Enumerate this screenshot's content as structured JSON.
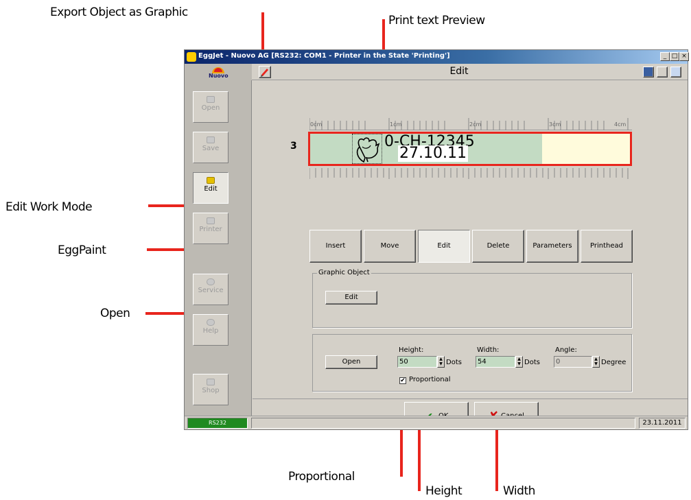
{
  "callouts": {
    "export_object_as_graphic": "Export Object as Graphic",
    "print_text_preview": "Print text Preview",
    "edit_work_mode": "Edit Work Mode",
    "eggpaint": "EggPaint",
    "open": "Open",
    "proportional": "Proportional",
    "height": "Height",
    "width": "Width"
  },
  "window": {
    "title": "EggJet - Nuovo AG   [RS232: COM1 - Printer in the State 'Printing']",
    "header_title": "Edit"
  },
  "sidebar": {
    "logo_text": "Nuovo",
    "items": [
      {
        "label": "Open",
        "icon": "folder-open-icon"
      },
      {
        "label": "Save",
        "icon": "folder-save-icon"
      },
      {
        "label": "Edit",
        "icon": "edit-icon"
      },
      {
        "label": "Printer",
        "icon": "printer-icon"
      },
      {
        "label": "Service",
        "icon": "service-icon"
      },
      {
        "label": "Help",
        "icon": "help-icon"
      },
      {
        "label": "Shop",
        "icon": "shop-icon"
      }
    ]
  },
  "status": {
    "rs232": "RS232",
    "date": "23.11.2011"
  },
  "ruler": {
    "units": [
      "0cm",
      "1cm",
      "2cm",
      "3cm",
      "4cm"
    ]
  },
  "preview": {
    "line_number": "3",
    "line1": "0-CH-12345",
    "line2": "27.10.11"
  },
  "tabs": [
    "Insert",
    "Move",
    "Edit",
    "Delete",
    "Parameters",
    "Printhead"
  ],
  "graphic_object": {
    "group_label": "Graphic Object",
    "edit_button": "Edit"
  },
  "size_panel": {
    "open_button": "Open",
    "height_label": "Height:",
    "height_value": "50",
    "height_unit": "Dots",
    "width_label": "Width:",
    "width_value": "54",
    "width_unit": "Dots",
    "angle_label": "Angle:",
    "angle_value": "0",
    "angle_unit": "Degree",
    "proportional_label": "Proportional",
    "proportional_checked": true
  },
  "dialog": {
    "ok_label": "OK",
    "cancel_label": "Cancel"
  },
  "colors": {
    "callout_red": "#e8251d",
    "preview_green": "#c3dbc3",
    "preview_yellow": "#fffbdc"
  }
}
